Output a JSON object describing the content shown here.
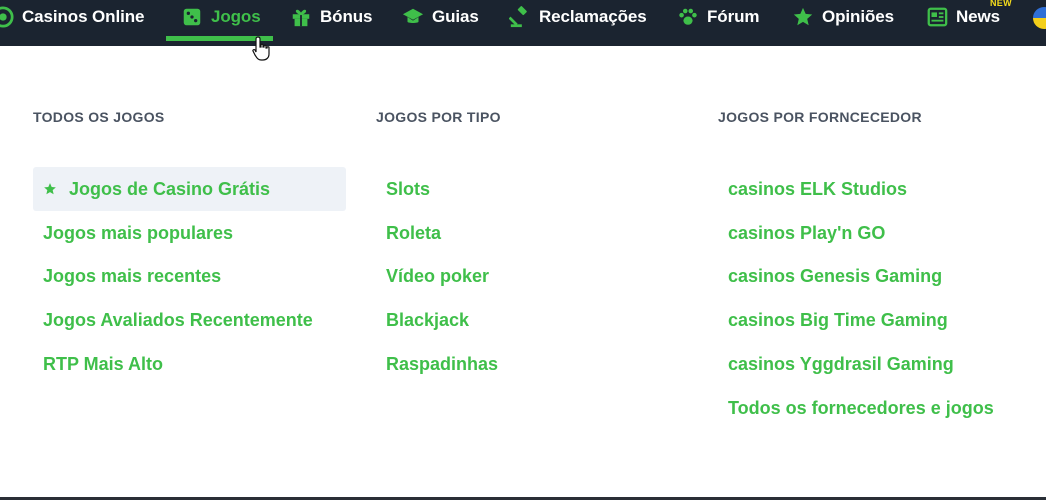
{
  "nav": {
    "items": [
      {
        "label": "Casinos Online",
        "icon": "poker-chip-icon"
      },
      {
        "label": "Jogos",
        "icon": "dice-icon",
        "active": true
      },
      {
        "label": "Bónus",
        "icon": "gift-icon"
      },
      {
        "label": "Guias",
        "icon": "graduation-cap-icon"
      },
      {
        "label": "Reclamações",
        "icon": "gavel-icon"
      },
      {
        "label": "Fórum",
        "icon": "paw-icon"
      },
      {
        "label": "Opiniões",
        "icon": "star-icon"
      },
      {
        "label": "News",
        "icon": "newspaper-icon",
        "badge": "NEW"
      }
    ],
    "accent_color": "#3fbf4a",
    "background_color": "#1b2430",
    "badge_color": "#f5dc1c"
  },
  "menu": {
    "columns": [
      {
        "title": "TODOS OS JOGOS",
        "links": [
          {
            "label": "Jogos de Casino Grátis",
            "icon": "star-icon",
            "highlighted": true
          },
          {
            "label": "Jogos mais populares"
          },
          {
            "label": "Jogos mais recentes"
          },
          {
            "label": "Jogos Avaliados Recentemente"
          },
          {
            "label": "RTP Mais Alto"
          }
        ]
      },
      {
        "title": "JOGOS POR TIPO",
        "links": [
          {
            "label": "Slots"
          },
          {
            "label": "Roleta"
          },
          {
            "label": "Vídeo poker"
          },
          {
            "label": "Blackjack"
          },
          {
            "label": "Raspadinhas"
          }
        ]
      },
      {
        "title": "JOGOS POR FORNCECEDOR",
        "links": [
          {
            "label": "casinos ELK Studios"
          },
          {
            "label": "casinos Play'n GO"
          },
          {
            "label": "casinos Genesis Gaming"
          },
          {
            "label": "casinos Big Time Gaming"
          },
          {
            "label": "casinos Yggdrasil Gaming"
          },
          {
            "label": "Todos os fornecedores e jogos"
          }
        ]
      }
    ],
    "link_color": "#3fbf4a",
    "highlight_background": "#eef2f7"
  }
}
